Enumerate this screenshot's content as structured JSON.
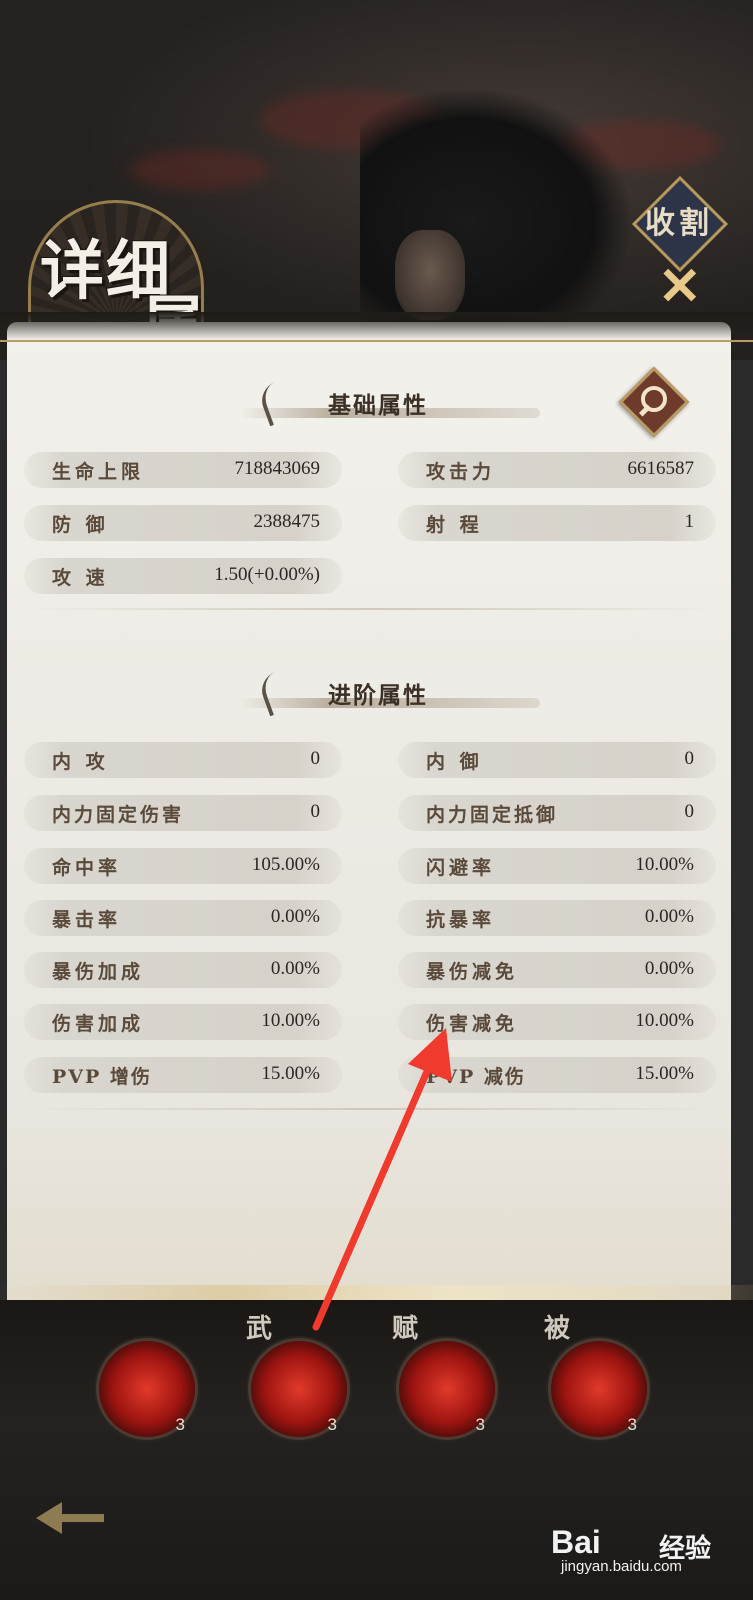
{
  "header": {
    "title_line1": "详细",
    "title_line2": "属性",
    "close_label": "收割",
    "close_mark": "✕"
  },
  "sections": {
    "basic_title": "基础属性",
    "advanced_title": "进阶属性"
  },
  "basic": [
    {
      "label": "生命上限",
      "value": "718843069"
    },
    {
      "label": "攻击力",
      "value": "6616587"
    },
    {
      "label": "防 御",
      "value": "2388475"
    },
    {
      "label": "射 程",
      "value": "1"
    },
    {
      "label": "攻 速",
      "value": "1.50(+0.00%)"
    }
  ],
  "advanced": [
    {
      "label": "内 攻",
      "value": "0"
    },
    {
      "label": "内 御",
      "value": "0"
    },
    {
      "label": "内力固定伤害",
      "value": "0"
    },
    {
      "label": "内力固定抵御",
      "value": "0"
    },
    {
      "label": "命中率",
      "value": "105.00%"
    },
    {
      "label": "闪避率",
      "value": "10.00%"
    },
    {
      "label": "暴击率",
      "value": "0.00%"
    },
    {
      "label": "抗暴率",
      "value": "0.00%"
    },
    {
      "label": "暴伤加成",
      "value": "0.00%"
    },
    {
      "label": "暴伤减免",
      "value": "0.00%"
    },
    {
      "label": "伤害加成",
      "value": "10.00%"
    },
    {
      "label": "伤害减免",
      "value": "10.00%"
    },
    {
      "label": "PVP 增伤",
      "value": "15.00%"
    },
    {
      "label": "PVP 减伤",
      "value": "15.00%"
    }
  ],
  "skills": [
    {
      "tag": "",
      "level": "3"
    },
    {
      "tag": "武",
      "level": "3"
    },
    {
      "tag": "赋",
      "level": "3"
    },
    {
      "tag": "被",
      "level": "3"
    }
  ],
  "watermark": {
    "brand": "Bai",
    "brand2": "经验",
    "domain": "jingyan.baidu.com"
  },
  "colors": {
    "panel": "#f3f1ec",
    "accent_gold": "#b79c63",
    "annotation_arrow": "#f03a2e"
  }
}
